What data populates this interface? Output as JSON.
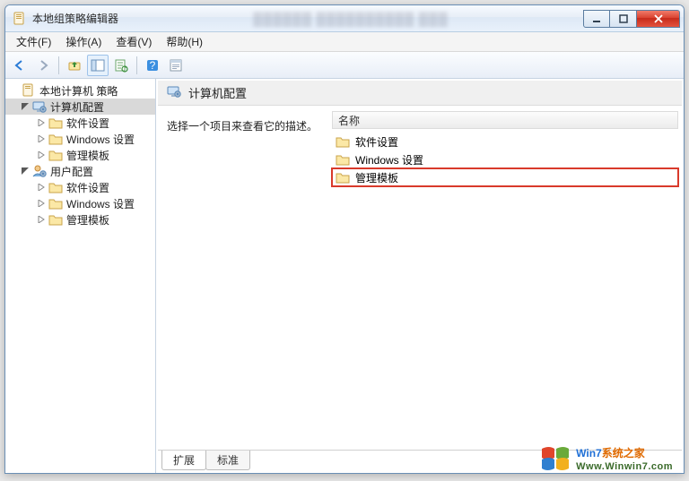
{
  "colors": {
    "highlight_outline": "#d93a2b"
  },
  "window": {
    "title": "本地组策略编辑器"
  },
  "menu": {
    "file": "文件(F)",
    "action": "操作(A)",
    "view": "查看(V)",
    "help": "帮助(H)"
  },
  "toolbar_icons": {
    "back": "back-icon",
    "forward": "forward-icon",
    "up": "up-icon",
    "show_hide_tree": "show-hide-tree-icon",
    "refresh": "refresh-icon",
    "export": "export-icon",
    "help": "help-icon",
    "properties": "properties-icon"
  },
  "tree": {
    "root": {
      "label": "本地计算机 策略"
    },
    "computer": {
      "label": "计算机配置",
      "expanded": true,
      "children": [
        {
          "key": "software",
          "label": "软件设置"
        },
        {
          "key": "windows",
          "label": "Windows 设置"
        },
        {
          "key": "admintemplates",
          "label": "管理模板"
        }
      ]
    },
    "user": {
      "label": "用户配置",
      "expanded": true,
      "children": [
        {
          "key": "software",
          "label": "软件设置"
        },
        {
          "key": "windows",
          "label": "Windows 设置"
        },
        {
          "key": "admintemplates",
          "label": "管理模板"
        }
      ]
    }
  },
  "content": {
    "header_title": "计算机配置",
    "description_prompt": "选择一个项目来查看它的描述。",
    "column_name": "名称",
    "items": [
      {
        "key": "software",
        "label": "软件设置",
        "highlight": false
      },
      {
        "key": "windows",
        "label": "Windows 设置",
        "highlight": false
      },
      {
        "key": "admintemplates",
        "label": "管理模板",
        "highlight": true
      }
    ]
  },
  "tabs": {
    "extended": "扩展",
    "standard": "标准"
  },
  "watermark": {
    "brand_prefix": "Win7",
    "brand_suffix": "系统之家",
    "url": "Www.Winwin7.com"
  }
}
